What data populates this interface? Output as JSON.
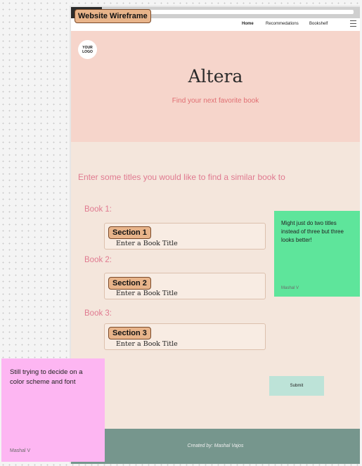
{
  "wireframe_label": "Website Wireframe",
  "nav": {
    "items": [
      "Home",
      "Recommedations",
      "Bookshelf"
    ]
  },
  "hero": {
    "logo_text": "YOUR LOGO",
    "title": "Altera",
    "subtitle": "Find your next favorite book"
  },
  "form": {
    "prompt": "Enter some titles you would like to find a similar book to",
    "books": [
      {
        "label": "Book 1:",
        "section": "Section 1",
        "placeholder": "Enter a Book Title"
      },
      {
        "label": "Book 2:",
        "section": "Section 2",
        "placeholder": "Enter a Book Title"
      },
      {
        "label": "Book 3:",
        "section": "Section 3",
        "placeholder": "Enter a Book Title"
      }
    ],
    "submit_label": "Submit"
  },
  "footer": {
    "credit": "Created by: Mashal Vajos"
  },
  "sticky_notes": [
    {
      "text": "Might just do two titles instead of three but three looks better!",
      "author": "Mashal V",
      "color": "#5ee59b"
    },
    {
      "text": "Still trying to decide on a color scheme and font",
      "author": "Mashal V",
      "color": "#fdb6f2"
    }
  ],
  "colors": {
    "hero_bg": "#f6d5cb",
    "content_bg": "#f4e6dc",
    "accent_text": "#e07a90",
    "footer_bg": "#76968d",
    "submit_bg": "#bde3d8",
    "chip_bg": "#e8b48a"
  }
}
